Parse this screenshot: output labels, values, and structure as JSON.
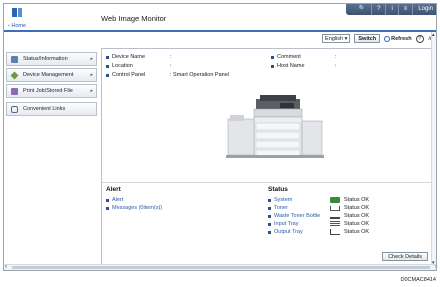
{
  "header": {
    "app_title": "Web Image Monitor",
    "home_link": "Home",
    "tools": {
      "search": "🔍",
      "help": "?",
      "info": "i",
      "menu": "≡",
      "login": "Login"
    }
  },
  "controls": {
    "language": "English",
    "switch_label": "Switch",
    "refresh_label": "Refresh",
    "help_glyph": "?",
    "collapse_glyph": "∧"
  },
  "nav": {
    "items": [
      {
        "label": "Status/Information",
        "icon": "info-icon"
      },
      {
        "label": "Device Management",
        "icon": "device-icon"
      },
      {
        "label": "Print Job/Stored File",
        "icon": "print-icon"
      },
      {
        "label": "Convenient Links",
        "icon": "link-icon"
      }
    ]
  },
  "device_info": {
    "device_name_label": "Device Name",
    "device_name": ":",
    "location_label": "Location",
    "location": ":",
    "control_panel_label": "Control Panel",
    "control_panel": ": Smart Operation Panel",
    "comment_label": "Comment",
    "comment": ":",
    "host_name_label": "Host Name",
    "host_name": ":"
  },
  "alert": {
    "title": "Alert",
    "items": [
      "Alert",
      "Messages (0item(s))"
    ]
  },
  "status": {
    "title": "Status",
    "items": [
      {
        "name": "System",
        "value": "Status OK",
        "icon": "system-icon"
      },
      {
        "name": "Toner",
        "value": "Status OK",
        "icon": "toner-icon"
      },
      {
        "name": "Waste Toner Bottle",
        "value": "Status OK",
        "icon": "waste-toner-icon"
      },
      {
        "name": "Input Tray",
        "value": "Status OK",
        "icon": "input-tray-icon"
      },
      {
        "name": "Output Tray",
        "value": "Status OK",
        "icon": "output-tray-icon"
      }
    ],
    "check_details_label": "Check Details"
  },
  "footer_code": "D0CMAC8414"
}
